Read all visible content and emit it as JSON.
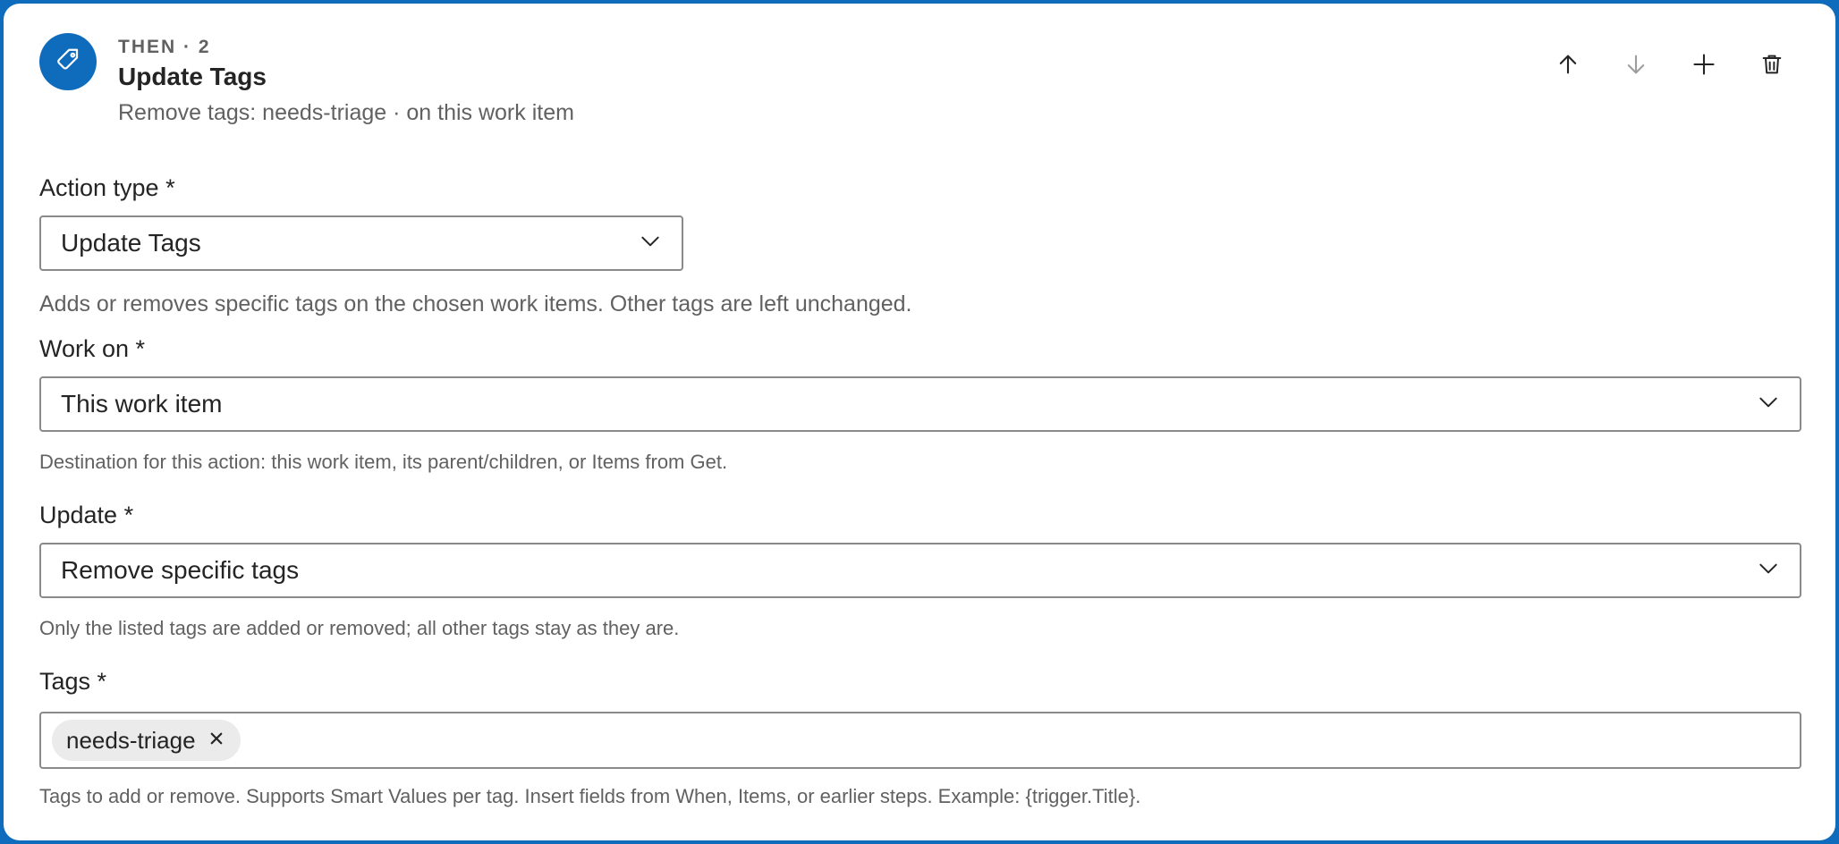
{
  "header": {
    "eyebrow": "THEN · 2",
    "title": "Update Tags",
    "summary": "Remove tags: needs-triage · on this work item",
    "icon": "tag-icon",
    "accent_color": "#0f6cbd"
  },
  "toolbar": {
    "move_up_icon": "arrow-up-icon",
    "move_down_icon": "arrow-down-icon",
    "add_icon": "plus-icon",
    "delete_icon": "trash-icon"
  },
  "action_type": {
    "label": "Action type *",
    "value": "Update Tags",
    "description": "Adds or removes specific tags on the chosen work items. Other tags are left unchanged."
  },
  "work_on": {
    "label": "Work on *",
    "value": "This work item",
    "description": "Destination for this action: this work item, its parent/children, or Items from Get."
  },
  "update": {
    "label": "Update *",
    "value": "Remove specific tags",
    "description": "Only the listed tags are added or removed; all other tags stay as they are."
  },
  "tags": {
    "label": "Tags *",
    "items": [
      "needs-triage"
    ],
    "description": "Tags to add or remove. Supports Smart Values per tag. Insert fields from When, Items, or earlier steps. Example: {trigger.Title}."
  }
}
